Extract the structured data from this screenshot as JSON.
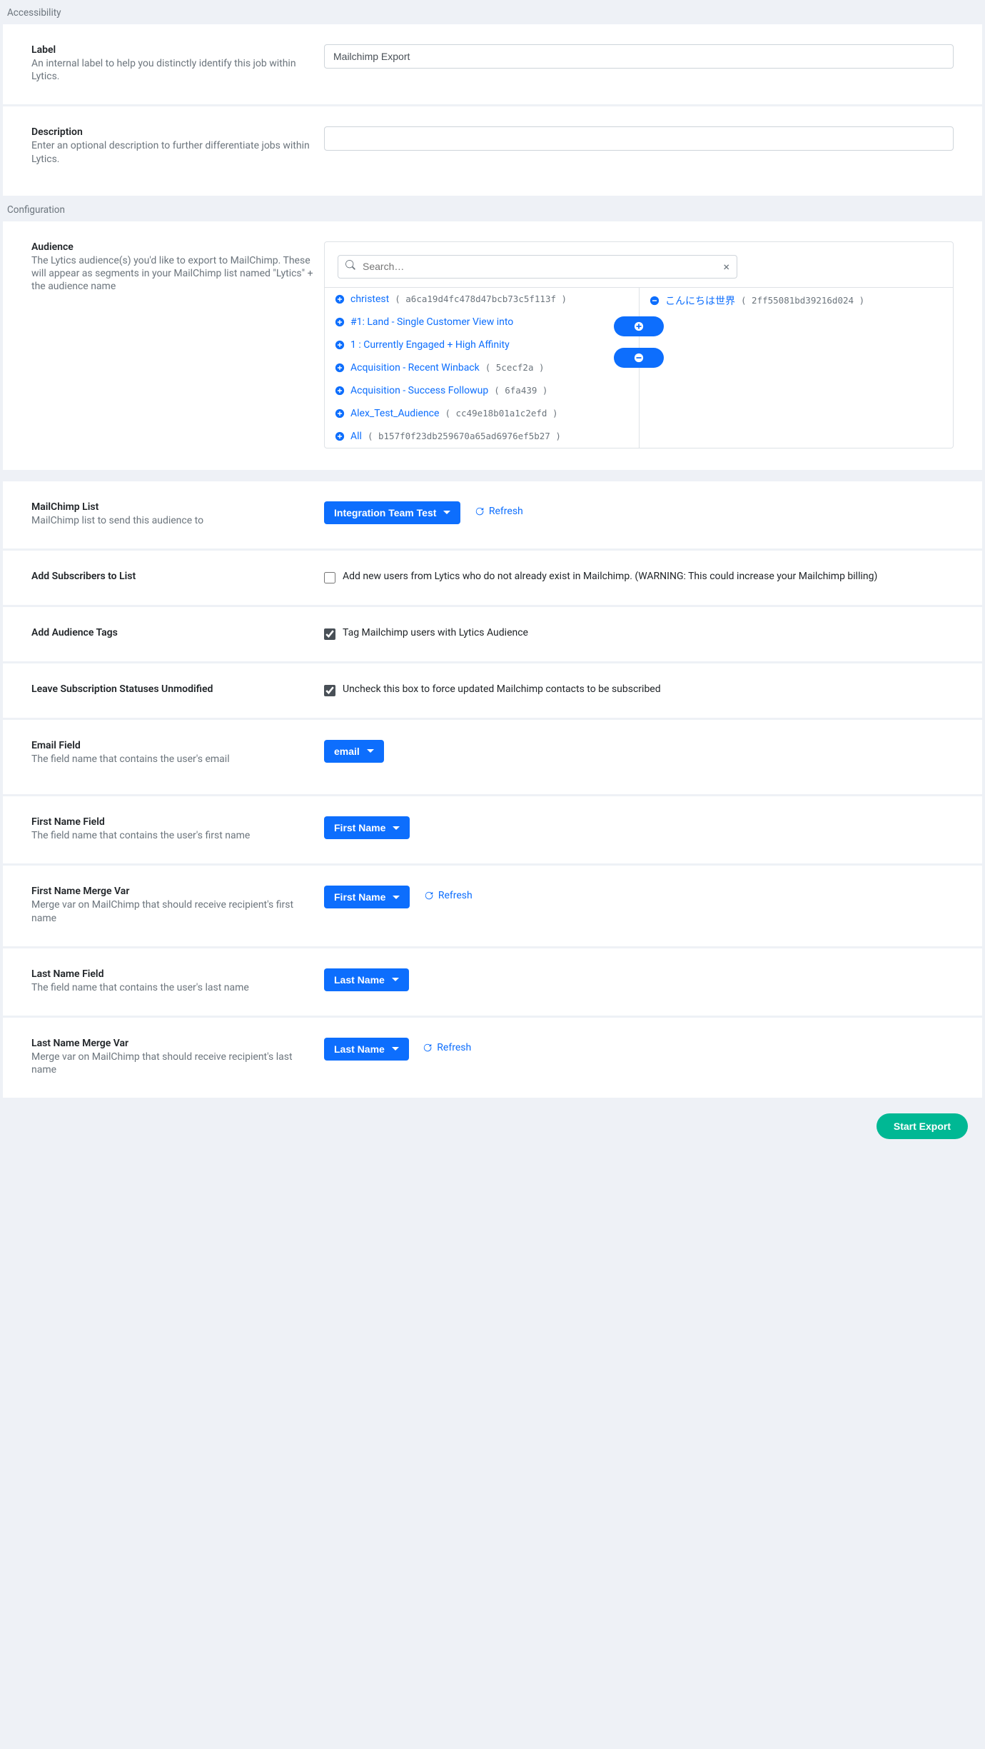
{
  "sections": {
    "accessibility": "Accessibility",
    "configuration": "Configuration"
  },
  "label": {
    "title": "Label",
    "help": "An internal label to help you distinctly identify this job within Lytics.",
    "value": "Mailchimp Export"
  },
  "description": {
    "title": "Description",
    "help": "Enter an optional description to further differentiate jobs within Lytics.",
    "value": ""
  },
  "audience": {
    "title": "Audience",
    "help": "The Lytics audience(s) you'd like to export to MailChimp. These will appear as segments in your MailChimp list named \"Lytics\" + the audience name",
    "search_placeholder": "Search…",
    "available": [
      {
        "name": "christest",
        "hash": "a6ca19d4fc478d47bcb73c5f113f"
      },
      {
        "name": "#1: Land - Single Customer View into",
        "hash": ""
      },
      {
        "name": "1 : Currently Engaged + High Affinity",
        "hash": ""
      },
      {
        "name": "Acquisition - Recent Winback",
        "hash": "5cecf2a"
      },
      {
        "name": "Acquisition - Success Followup",
        "hash": "6fa439"
      },
      {
        "name": "Alex_Test_Audience",
        "hash": "cc49e18b01a1c2efd"
      },
      {
        "name": "All",
        "hash": "b157f0f23db259670a65ad6976ef5b27"
      }
    ],
    "selected": [
      {
        "name": "こんにちは世界",
        "hash": "2ff55081bd39216d024"
      }
    ]
  },
  "mailchimp_list": {
    "title": "MailChimp List",
    "help": "MailChimp list to send this audience to",
    "value": "Integration Team Test",
    "refresh": "Refresh"
  },
  "add_subscribers": {
    "title": "Add Subscribers to List",
    "text": "Add new users from Lytics who do not already exist in Mailchimp. (WARNING: This could increase your Mailchimp billing)",
    "checked": false
  },
  "add_tags": {
    "title": "Add Audience Tags",
    "text": "Tag Mailchimp users with Lytics Audience",
    "checked": true
  },
  "leave_status": {
    "title": "Leave Subscription Statuses Unmodified",
    "text": "Uncheck this box to force updated Mailchimp contacts to be subscribed",
    "checked": true
  },
  "email_field": {
    "title": "Email Field",
    "help": "The field name that contains the user's email",
    "value": "email"
  },
  "first_name_field": {
    "title": "First Name Field",
    "help": "The field name that contains the user's first name",
    "value": "First Name"
  },
  "first_name_merge": {
    "title": "First Name Merge Var",
    "help": "Merge var on MailChimp that should receive recipient's first name",
    "value": "First Name",
    "refresh": "Refresh"
  },
  "last_name_field": {
    "title": "Last Name Field",
    "help": "The field name that contains the user's last name",
    "value": "Last Name"
  },
  "last_name_merge": {
    "title": "Last Name Merge Var",
    "help": "Merge var on MailChimp that should receive recipient's last name",
    "value": "Last Name",
    "refresh": "Refresh"
  },
  "footer": {
    "start": "Start Export"
  }
}
